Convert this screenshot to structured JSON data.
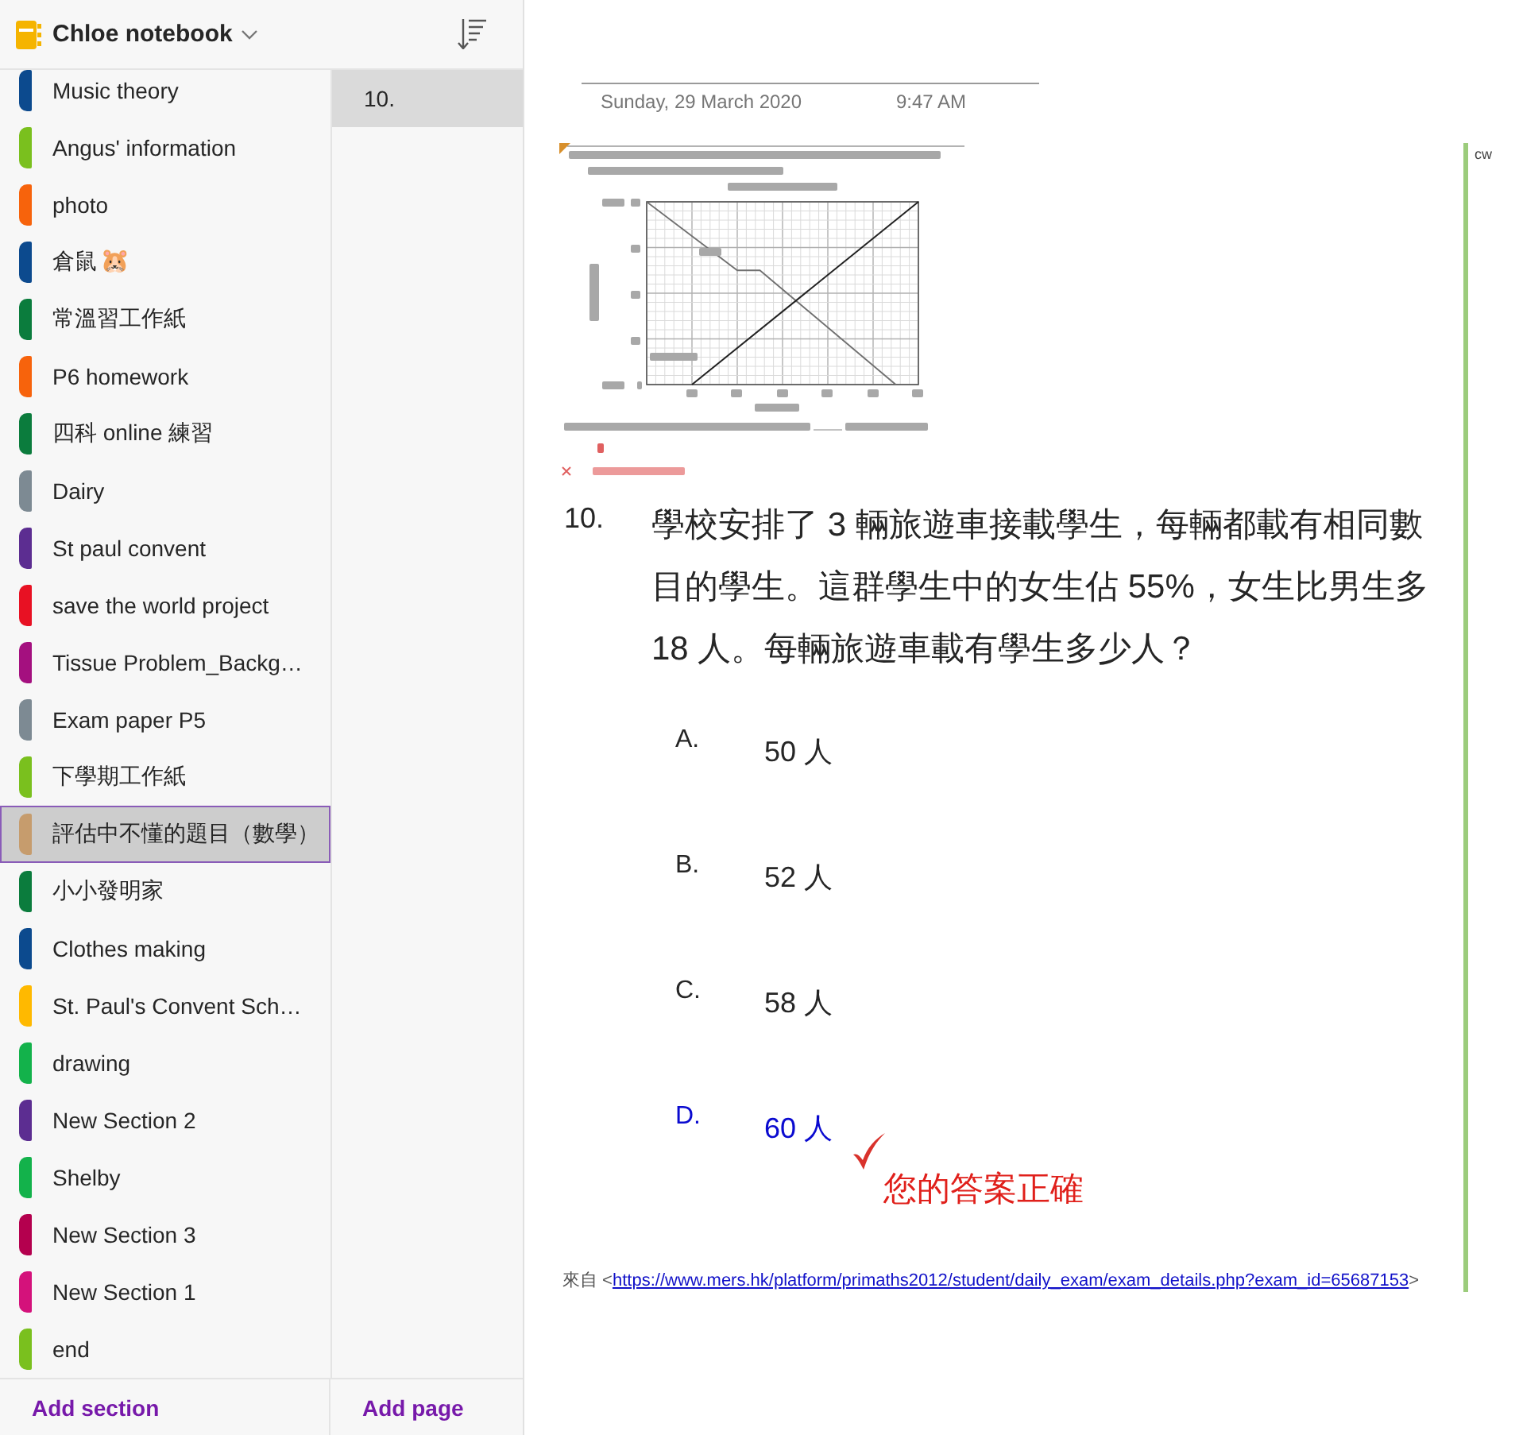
{
  "notebook": {
    "title": "Chloe notebook"
  },
  "sections": [
    {
      "label": "Music theory",
      "color": "#0c4a8e",
      "selected": false
    },
    {
      "label": "Angus' information",
      "color": "#7ac01e",
      "selected": false
    },
    {
      "label": "photo",
      "color": "#f7630c",
      "selected": false
    },
    {
      "label": "倉鼠",
      "emoji": "🐹",
      "color": "#0c4a8e",
      "selected": false
    },
    {
      "label": "常溫習工作紙",
      "color": "#0b7c3d",
      "selected": false
    },
    {
      "label": "P6 homework",
      "color": "#f7630c",
      "selected": false
    },
    {
      "label": "四科 online 練習",
      "color": "#0b7c3d",
      "selected": false
    },
    {
      "label": "Dairy",
      "color": "#7d8a93",
      "selected": false
    },
    {
      "label": "St paul convent",
      "color": "#5c2d91",
      "selected": false
    },
    {
      "label": "save the world project",
      "color": "#e81123",
      "selected": false
    },
    {
      "label": "Tissue Problem_Backg…",
      "color": "#a4107f",
      "selected": false
    },
    {
      "label": "Exam paper P5",
      "color": "#7d8a93",
      "selected": false
    },
    {
      "label": "下學期工作紙",
      "color": "#7ac01e",
      "selected": false
    },
    {
      "label": "評估中不懂的題目（數學）",
      "color": "#c69c6d",
      "selected": true
    },
    {
      "label": "小小發明家",
      "color": "#0b7c3d",
      "selected": false
    },
    {
      "label": "Clothes making",
      "color": "#0c4a8e",
      "selected": false
    },
    {
      "label": "St. Paul's Convent Sch…",
      "color": "#ffb900",
      "selected": false
    },
    {
      "label": "drawing",
      "color": "#13b24b",
      "selected": false
    },
    {
      "label": "New Section 2",
      "color": "#5c2d91",
      "selected": false
    },
    {
      "label": "Shelby",
      "color": "#13b24b",
      "selected": false
    },
    {
      "label": "New Section 3",
      "color": "#b4004e",
      "selected": false
    },
    {
      "label": "New Section 1",
      "color": "#d4127b",
      "selected": false
    },
    {
      "label": "end",
      "color": "#7ac01e",
      "selected": false
    }
  ],
  "pages": [
    {
      "label": "10.",
      "selected": true
    }
  ],
  "footer": {
    "add_section": "Add section",
    "add_page": "Add page"
  },
  "note": {
    "date": "Sunday, 29 March 2020",
    "time": "9:47 AM",
    "question_number": "10.",
    "question": "學校安排了 3 輛旅遊車接載學生，每輛都載有相同數目的學生。這群學生中的女生佔 55%，女生比男生多 18 人。每輛旅遊車載有學生多少人？",
    "options": [
      {
        "letter": "A.",
        "answer": "50 人",
        "selected": false
      },
      {
        "letter": "B.",
        "answer": "52 人",
        "selected": false
      },
      {
        "letter": "C.",
        "answer": "58 人",
        "selected": false
      },
      {
        "letter": "D.",
        "answer": "60 人",
        "selected": true
      }
    ],
    "feedback": "您的答案正確",
    "source": {
      "prefix": "來自 <",
      "url": "https://www.mers.hk/platform/primaths2012/student/daily_exam/exam_details.php?exam_id=65687153",
      "suffix": ">"
    },
    "author": "cw"
  }
}
